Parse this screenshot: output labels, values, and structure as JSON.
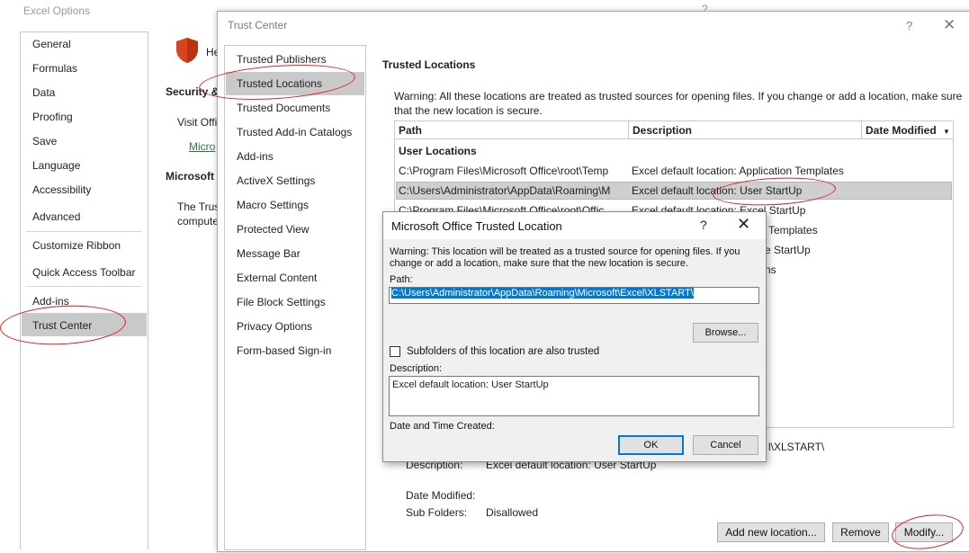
{
  "excel_options": {
    "title": "Excel Options",
    "help_glyph": "?",
    "nav_items": [
      "General",
      "Formulas",
      "Data",
      "Proofing",
      "Save",
      "Language",
      "Accessibility",
      "Advanced",
      "Customize Ribbon",
      "Quick Access Toolbar",
      "Add-ins",
      "Trust Center"
    ],
    "selected": "Trust Center",
    "content": {
      "help_text": "He",
      "security_heading": "Security &",
      "visit_text": "Visit Offi",
      "micro_link": "Micro",
      "microsoft_heading": "Microsoft",
      "trust_line1": "The Trust",
      "trust_line2": "compute"
    }
  },
  "trust_center": {
    "title": "Trust Center",
    "help_glyph": "?",
    "close_glyph": "✕",
    "nav_items": [
      "Trusted Publishers",
      "Trusted Locations",
      "Trusted Documents",
      "Trusted Add-in Catalogs",
      "Add-ins",
      "ActiveX Settings",
      "Macro Settings",
      "Protected View",
      "Message Bar",
      "External Content",
      "File Block Settings",
      "Privacy Options",
      "Form-based Sign-in"
    ],
    "selected": "Trusted Locations",
    "heading": "Trusted Locations",
    "warning": "Warning: All these locations are treated as trusted sources for opening files.  If you change or add a location, make sure that the new location is secure.",
    "table": {
      "columns": [
        "Path",
        "Description",
        "Date Modified"
      ],
      "sort_glyph": "▼",
      "group": "User Locations",
      "rows": [
        {
          "path": "C:\\Program Files\\Microsoft Office\\root\\Temp",
          "description": "Excel default location: Application Templates"
        },
        {
          "path": "C:\\Users\\Administrator\\AppData\\Roaming\\M",
          "description": "Excel default location: User StartUp"
        },
        {
          "path": "C:\\Program Files\\Microsoft Office\\root\\Offic",
          "description": "Excel default location: Excel StartUp"
        }
      ],
      "partial_rows": [
        "Templates",
        "e StartUp",
        "ns"
      ]
    },
    "details": {
      "path_tail": "l\\XLSTART\\",
      "description_label": "Description:",
      "description_value": "Excel default location: User StartUp",
      "date_modified_label": "Date Modified:",
      "sub_folders_label": "Sub Folders:",
      "sub_folders_value": "Disallowed"
    },
    "buttons": {
      "add": "Add new location...",
      "remove": "Remove",
      "modify": "Modify..."
    }
  },
  "dialog": {
    "title": "Microsoft Office Trusted Location",
    "help_glyph": "?",
    "close_glyph": "✕",
    "warning": "Warning: This location will be treated as a trusted source for opening files. If you change or add a location, make sure that the new location is secure.",
    "path_label": "Path:",
    "path_value": "C:\\Users\\Administrator\\AppData\\Roaming\\Microsoft\\Excel\\XLSTART\\",
    "browse": "Browse...",
    "subfolders_label": "Subfolders of this location are also trusted",
    "description_label": "Description:",
    "description_value": "Excel default location: User StartUp",
    "date_label": "Date and Time Created:",
    "ok": "OK",
    "cancel": "Cancel"
  }
}
